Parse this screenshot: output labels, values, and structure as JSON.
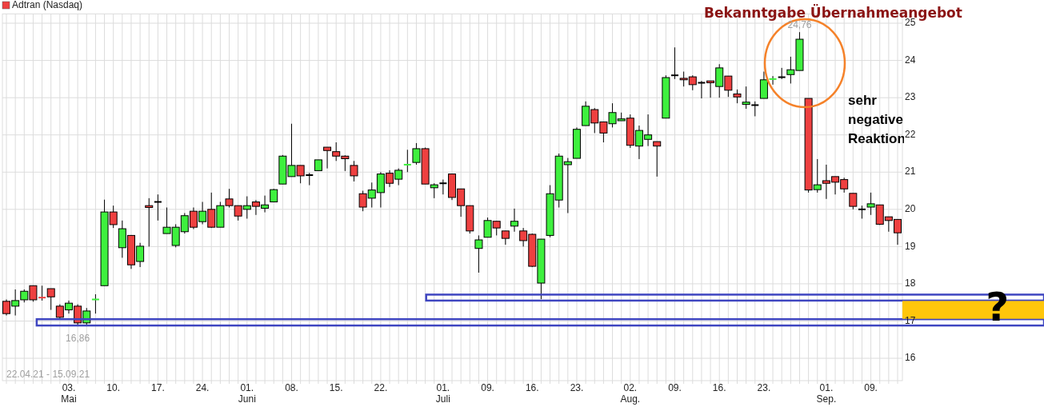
{
  "chart": {
    "legend": "Adtran (Nasdaq)",
    "chart_data": {
      "type": "candlestick",
      "title": "Bekanntgabe Übernahmeangebot",
      "grid": true,
      "ylim": [
        15.4,
        25.25
      ],
      "yticks": [
        16,
        17,
        18,
        19,
        20,
        21,
        22,
        23,
        24,
        25
      ],
      "categories": [
        null,
        null,
        null,
        null,
        null,
        null,
        null,
        "03.",
        null,
        null,
        null,
        null,
        "10.",
        null,
        null,
        null,
        null,
        "17.",
        null,
        null,
        null,
        null,
        "24.",
        null,
        null,
        null,
        null,
        "01.",
        null,
        null,
        null,
        null,
        "08.",
        null,
        null,
        null,
        null,
        "15.",
        null,
        null,
        null,
        null,
        "22.",
        null,
        null,
        null,
        null,
        null,
        null,
        "01.",
        null,
        null,
        null,
        null,
        "09.",
        null,
        null,
        null,
        null,
        "16.",
        null,
        null,
        null,
        null,
        "23.",
        null,
        null,
        null,
        null,
        null,
        "02.",
        null,
        null,
        null,
        null,
        "09.",
        null,
        null,
        null,
        null,
        "16.",
        null,
        null,
        null,
        null,
        "23.",
        null,
        null,
        null,
        null,
        null,
        null,
        "01.",
        null,
        null,
        null,
        null,
        "09.",
        null,
        null,
        null
      ],
      "ohlc": [
        [
          17.53,
          17.58,
          17.15,
          17.2
        ],
        [
          17.4,
          17.85,
          17.15,
          17.55
        ],
        [
          17.57,
          17.85,
          17.5,
          17.8
        ],
        [
          17.95,
          17.95,
          17.52,
          17.57
        ],
        [
          17.63,
          17.95,
          17.55,
          17.62
        ],
        [
          17.87,
          17.87,
          17.3,
          17.65
        ],
        [
          17.4,
          17.45,
          17.07,
          17.1
        ],
        [
          17.3,
          17.55,
          17.2,
          17.48
        ],
        [
          17.4,
          17.45,
          16.86,
          16.95
        ],
        [
          16.95,
          17.35,
          16.88,
          17.27
        ],
        [
          17.55,
          17.72,
          17.2,
          17.58
        ],
        [
          17.95,
          20.26,
          17.95,
          19.93
        ],
        [
          19.93,
          20.1,
          19.5,
          19.59
        ],
        [
          18.97,
          19.7,
          18.7,
          19.48
        ],
        [
          19.3,
          19.31,
          18.4,
          18.51
        ],
        [
          18.6,
          19.1,
          18.45,
          19.01
        ],
        [
          20.1,
          20.3,
          19.0,
          20.05
        ],
        [
          20.2,
          20.4,
          19.7,
          20.2
        ],
        [
          19.35,
          20.05,
          19.35,
          19.52
        ],
        [
          19.03,
          19.6,
          18.98,
          19.52
        ],
        [
          19.4,
          19.9,
          19.35,
          19.83
        ],
        [
          19.95,
          20.05,
          19.47,
          19.52
        ],
        [
          19.67,
          20.2,
          19.6,
          19.95
        ],
        [
          20.0,
          20.45,
          19.5,
          19.52
        ],
        [
          19.52,
          20.2,
          19.52,
          20.1
        ],
        [
          20.28,
          20.55,
          20.05,
          20.1
        ],
        [
          20.1,
          20.1,
          19.7,
          19.82
        ],
        [
          20.0,
          20.35,
          19.75,
          20.1
        ],
        [
          20.2,
          20.25,
          19.85,
          20.08
        ],
        [
          20.03,
          20.37,
          19.92,
          20.12
        ],
        [
          20.2,
          20.55,
          20.2,
          20.53
        ],
        [
          20.68,
          21.46,
          20.68,
          21.43
        ],
        [
          20.88,
          22.3,
          20.88,
          21.18
        ],
        [
          21.18,
          21.18,
          20.7,
          20.9
        ],
        [
          20.92,
          20.98,
          20.65,
          20.92
        ],
        [
          21.04,
          21.33,
          21.04,
          21.33
        ],
        [
          21.67,
          21.67,
          21.1,
          21.58
        ],
        [
          21.55,
          21.8,
          21.3,
          21.43
        ],
        [
          21.43,
          21.45,
          21.03,
          21.36
        ],
        [
          21.18,
          21.3,
          20.75,
          20.9
        ],
        [
          20.42,
          20.5,
          19.95,
          20.06
        ],
        [
          20.3,
          20.72,
          20.05,
          20.52
        ],
        [
          20.45,
          21.0,
          20.05,
          20.95
        ],
        [
          20.97,
          21.05,
          20.6,
          20.7
        ],
        [
          20.81,
          21.1,
          20.65,
          21.05
        ],
        [
          21.17,
          21.6,
          21.0,
          21.2
        ],
        [
          21.26,
          21.78,
          21.2,
          21.63
        ],
        [
          21.63,
          21.66,
          20.68,
          20.68
        ],
        [
          20.58,
          20.7,
          20.3,
          20.66
        ],
        [
          20.7,
          20.8,
          20.4,
          20.7
        ],
        [
          20.95,
          20.95,
          20.25,
          20.32
        ],
        [
          20.55,
          20.55,
          19.8,
          20.1
        ],
        [
          20.1,
          20.1,
          19.35,
          19.42
        ],
        [
          18.95,
          19.3,
          18.3,
          19.18
        ],
        [
          19.25,
          19.78,
          19.25,
          19.7
        ],
        [
          19.68,
          19.68,
          19.3,
          19.5
        ],
        [
          19.42,
          19.42,
          19.05,
          19.22
        ],
        [
          19.55,
          20.02,
          19.4,
          19.68
        ],
        [
          19.42,
          19.5,
          19.0,
          19.16
        ],
        [
          19.33,
          19.35,
          18.45,
          18.47
        ],
        [
          18.02,
          19.2,
          17.59,
          19.2
        ],
        [
          19.3,
          20.65,
          19.25,
          20.42
        ],
        [
          20.25,
          21.5,
          20.05,
          21.43
        ],
        [
          21.2,
          21.38,
          19.9,
          21.28
        ],
        [
          21.37,
          22.2,
          21.37,
          22.15
        ],
        [
          22.25,
          22.9,
          22.25,
          22.77
        ],
        [
          22.68,
          22.72,
          22.05,
          22.32
        ],
        [
          22.35,
          22.35,
          21.8,
          22.05
        ],
        [
          22.3,
          22.85,
          22.2,
          22.6
        ],
        [
          22.38,
          22.6,
          22.38,
          22.43
        ],
        [
          22.45,
          22.55,
          21.65,
          21.72
        ],
        [
          21.7,
          22.25,
          21.35,
          22.12
        ],
        [
          21.88,
          22.55,
          21.7,
          22.0
        ],
        [
          21.82,
          21.82,
          20.88,
          21.7
        ],
        [
          22.45,
          23.6,
          22.45,
          23.54
        ],
        [
          23.6,
          24.35,
          23.5,
          23.6
        ],
        [
          23.52,
          23.7,
          23.3,
          23.48
        ],
        [
          23.56,
          23.6,
          23.2,
          23.35
        ],
        [
          23.4,
          23.45,
          22.98,
          23.4
        ],
        [
          23.45,
          23.45,
          23.0,
          23.4
        ],
        [
          23.3,
          23.9,
          23.0,
          23.8
        ],
        [
          23.58,
          23.58,
          23.02,
          23.2
        ],
        [
          23.1,
          23.22,
          22.85,
          23.02
        ],
        [
          22.82,
          23.3,
          22.7,
          22.88
        ],
        [
          22.8,
          22.9,
          22.5,
          22.8
        ],
        [
          22.98,
          23.7,
          22.98,
          23.48
        ],
        [
          23.47,
          23.58,
          23.35,
          23.5
        ],
        [
          23.55,
          23.8,
          23.5,
          23.55
        ],
        [
          23.62,
          24.1,
          23.38,
          23.75
        ],
        [
          23.73,
          24.76,
          23.73,
          24.57
        ],
        [
          22.98,
          22.98,
          20.45,
          20.52
        ],
        [
          20.53,
          21.35,
          20.45,
          20.66
        ],
        [
          20.77,
          21.2,
          20.28,
          20.7
        ],
        [
          20.88,
          20.88,
          20.4,
          20.73
        ],
        [
          20.8,
          20.85,
          20.45,
          20.55
        ],
        [
          20.43,
          20.43,
          20.0,
          20.08
        ],
        [
          20.0,
          20.1,
          19.75,
          20.0
        ],
        [
          20.06,
          20.45,
          19.85,
          20.15
        ],
        [
          20.12,
          20.12,
          19.58,
          19.6
        ],
        [
          19.8,
          19.8,
          19.4,
          19.7
        ],
        [
          19.73,
          19.73,
          19.05,
          19.37
        ]
      ],
      "annotations": [
        "24,76",
        "sehr negative Reaktion",
        "?",
        "16,86",
        "22.04.21 - 15.09.21",
        "Mai",
        "Juni",
        "Juli",
        "Aug.",
        "Sep."
      ]
    }
  }
}
